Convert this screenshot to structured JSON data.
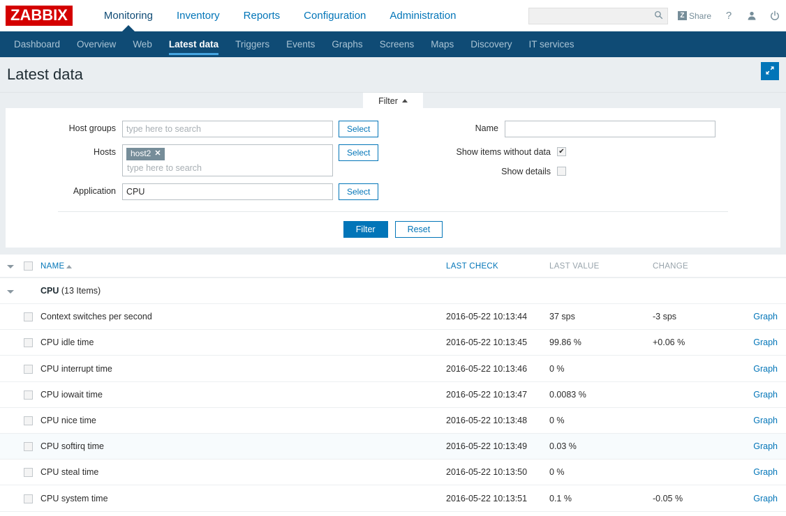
{
  "brand": {
    "logo": "ZABBIX"
  },
  "mainnav": {
    "items": [
      {
        "label": "Monitoring",
        "selected": true
      },
      {
        "label": "Inventory",
        "selected": false
      },
      {
        "label": "Reports",
        "selected": false
      },
      {
        "label": "Configuration",
        "selected": false
      },
      {
        "label": "Administration",
        "selected": false
      }
    ]
  },
  "header": {
    "search": {
      "value": "",
      "placeholder": "",
      "icon": "search-icon"
    },
    "share": {
      "label": "Share",
      "badge": "Z"
    },
    "help_icon": "?",
    "user_icon": "user-icon",
    "power_icon": "power-icon"
  },
  "subnav": {
    "items": [
      {
        "label": "Dashboard",
        "selected": false
      },
      {
        "label": "Overview",
        "selected": false
      },
      {
        "label": "Web",
        "selected": false
      },
      {
        "label": "Latest data",
        "selected": true
      },
      {
        "label": "Triggers",
        "selected": false
      },
      {
        "label": "Events",
        "selected": false
      },
      {
        "label": "Graphs",
        "selected": false
      },
      {
        "label": "Screens",
        "selected": false
      },
      {
        "label": "Maps",
        "selected": false
      },
      {
        "label": "Discovery",
        "selected": false
      },
      {
        "label": "IT services",
        "selected": false
      }
    ]
  },
  "page": {
    "title": "Latest data",
    "kiosk_button_icon": "expand-icon"
  },
  "filter": {
    "tab_label": "Filter",
    "tab_state_icon": "triangle-up",
    "host_groups": {
      "label": "Host groups",
      "value": "",
      "placeholder": "type here to search",
      "select_label": "Select"
    },
    "hosts": {
      "label": "Hosts",
      "chips": [
        {
          "label": "host2",
          "remove_icon": "✕"
        }
      ],
      "value": "",
      "placeholder": "type here to search",
      "select_label": "Select"
    },
    "application": {
      "label": "Application",
      "value": "CPU",
      "placeholder": "",
      "select_label": "Select"
    },
    "name": {
      "label": "Name",
      "value": "",
      "placeholder": ""
    },
    "show_items_without_data": {
      "label": "Show items without data",
      "checked": true,
      "mark": "✔"
    },
    "show_details": {
      "label": "Show details",
      "checked": false,
      "mark": ""
    },
    "apply_label": "Filter",
    "reset_label": "Reset"
  },
  "table": {
    "columns": {
      "name": "NAME",
      "last_check": "LAST CHECK",
      "last_value": "LAST VALUE",
      "change": "CHANGE"
    },
    "sort": {
      "column": "NAME",
      "direction": "asc"
    },
    "group": {
      "name": "CPU",
      "count": "(13 Items)"
    },
    "graph_link_label": "Graph",
    "rows": [
      {
        "name": "Context switches per second",
        "last_check": "2016-05-22 10:13:44",
        "last_value": "37 sps",
        "change": "-3 sps",
        "graph": "Graph",
        "alt": false
      },
      {
        "name": "CPU idle time",
        "last_check": "2016-05-22 10:13:45",
        "last_value": "99.86 %",
        "change": "+0.06 %",
        "graph": "Graph",
        "alt": false
      },
      {
        "name": "CPU interrupt time",
        "last_check": "2016-05-22 10:13:46",
        "last_value": "0 %",
        "change": "",
        "graph": "Graph",
        "alt": false
      },
      {
        "name": "CPU iowait time",
        "last_check": "2016-05-22 10:13:47",
        "last_value": "0.0083 %",
        "change": "",
        "graph": "Graph",
        "alt": false
      },
      {
        "name": "CPU nice time",
        "last_check": "2016-05-22 10:13:48",
        "last_value": "0 %",
        "change": "",
        "graph": "Graph",
        "alt": false
      },
      {
        "name": "CPU softirq time",
        "last_check": "2016-05-22 10:13:49",
        "last_value": "0.03 %",
        "change": "",
        "graph": "Graph",
        "alt": true
      },
      {
        "name": "CPU steal time",
        "last_check": "2016-05-22 10:13:50",
        "last_value": "0 %",
        "change": "",
        "graph": "Graph",
        "alt": false
      },
      {
        "name": "CPU system time",
        "last_check": "2016-05-22 10:13:51",
        "last_value": "0.1 %",
        "change": "-0.05 %",
        "graph": "Graph",
        "alt": false
      }
    ]
  },
  "colors": {
    "brand_red": "#d40000",
    "nav_dark": "#0f4b75",
    "link_blue": "#0275b8",
    "accent_underline": "#45a4e0",
    "chip_gray": "#768d99",
    "page_bg": "#eaeef1"
  }
}
